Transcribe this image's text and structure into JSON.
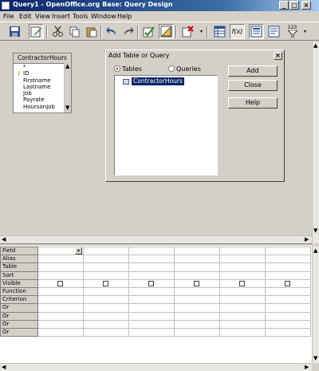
{
  "window": {
    "title": "Query1 - OpenOffice.org Base: Query Design",
    "minimize": "_",
    "maximize": "□",
    "close": "×"
  },
  "menu": [
    "File",
    "Edit",
    "View",
    "Insert",
    "Tools",
    "Window",
    "Help"
  ],
  "toolbar": {
    "icons": [
      "save-icon",
      "edit-icon",
      "cut-icon",
      "copy-icon",
      "paste-icon",
      "undo-icon",
      "redo-icon",
      "run-query-icon",
      "design-view-icon",
      "delete-icon",
      "add-tables-icon",
      "functions-icon",
      "table-name-icon",
      "alias-icon",
      "distinct-values-icon"
    ],
    "functions_label": "f(x)",
    "limit_label": "123"
  },
  "table_window": {
    "title": "ContractorHours",
    "fields": [
      "*",
      "ID",
      "Firstname",
      "Lastname",
      "Job",
      "Payrate",
      "Hoursonjob"
    ],
    "key_field": "ID"
  },
  "dialog": {
    "title": "Add Table or Query",
    "close": "×",
    "tab_tables": "Tables",
    "tab_queries": "Queries",
    "selected_tab": "Tables",
    "list_items": [
      "ContractorHours"
    ],
    "buttons": {
      "add": "Add",
      "close": "Close",
      "help": "Help"
    }
  },
  "grid": {
    "row_headers": [
      "Field",
      "Alias",
      "Table",
      "Sort",
      "Visible",
      "Function",
      "Criterion",
      "Or",
      "Or",
      "Or",
      "Or"
    ],
    "column_count": 6
  }
}
